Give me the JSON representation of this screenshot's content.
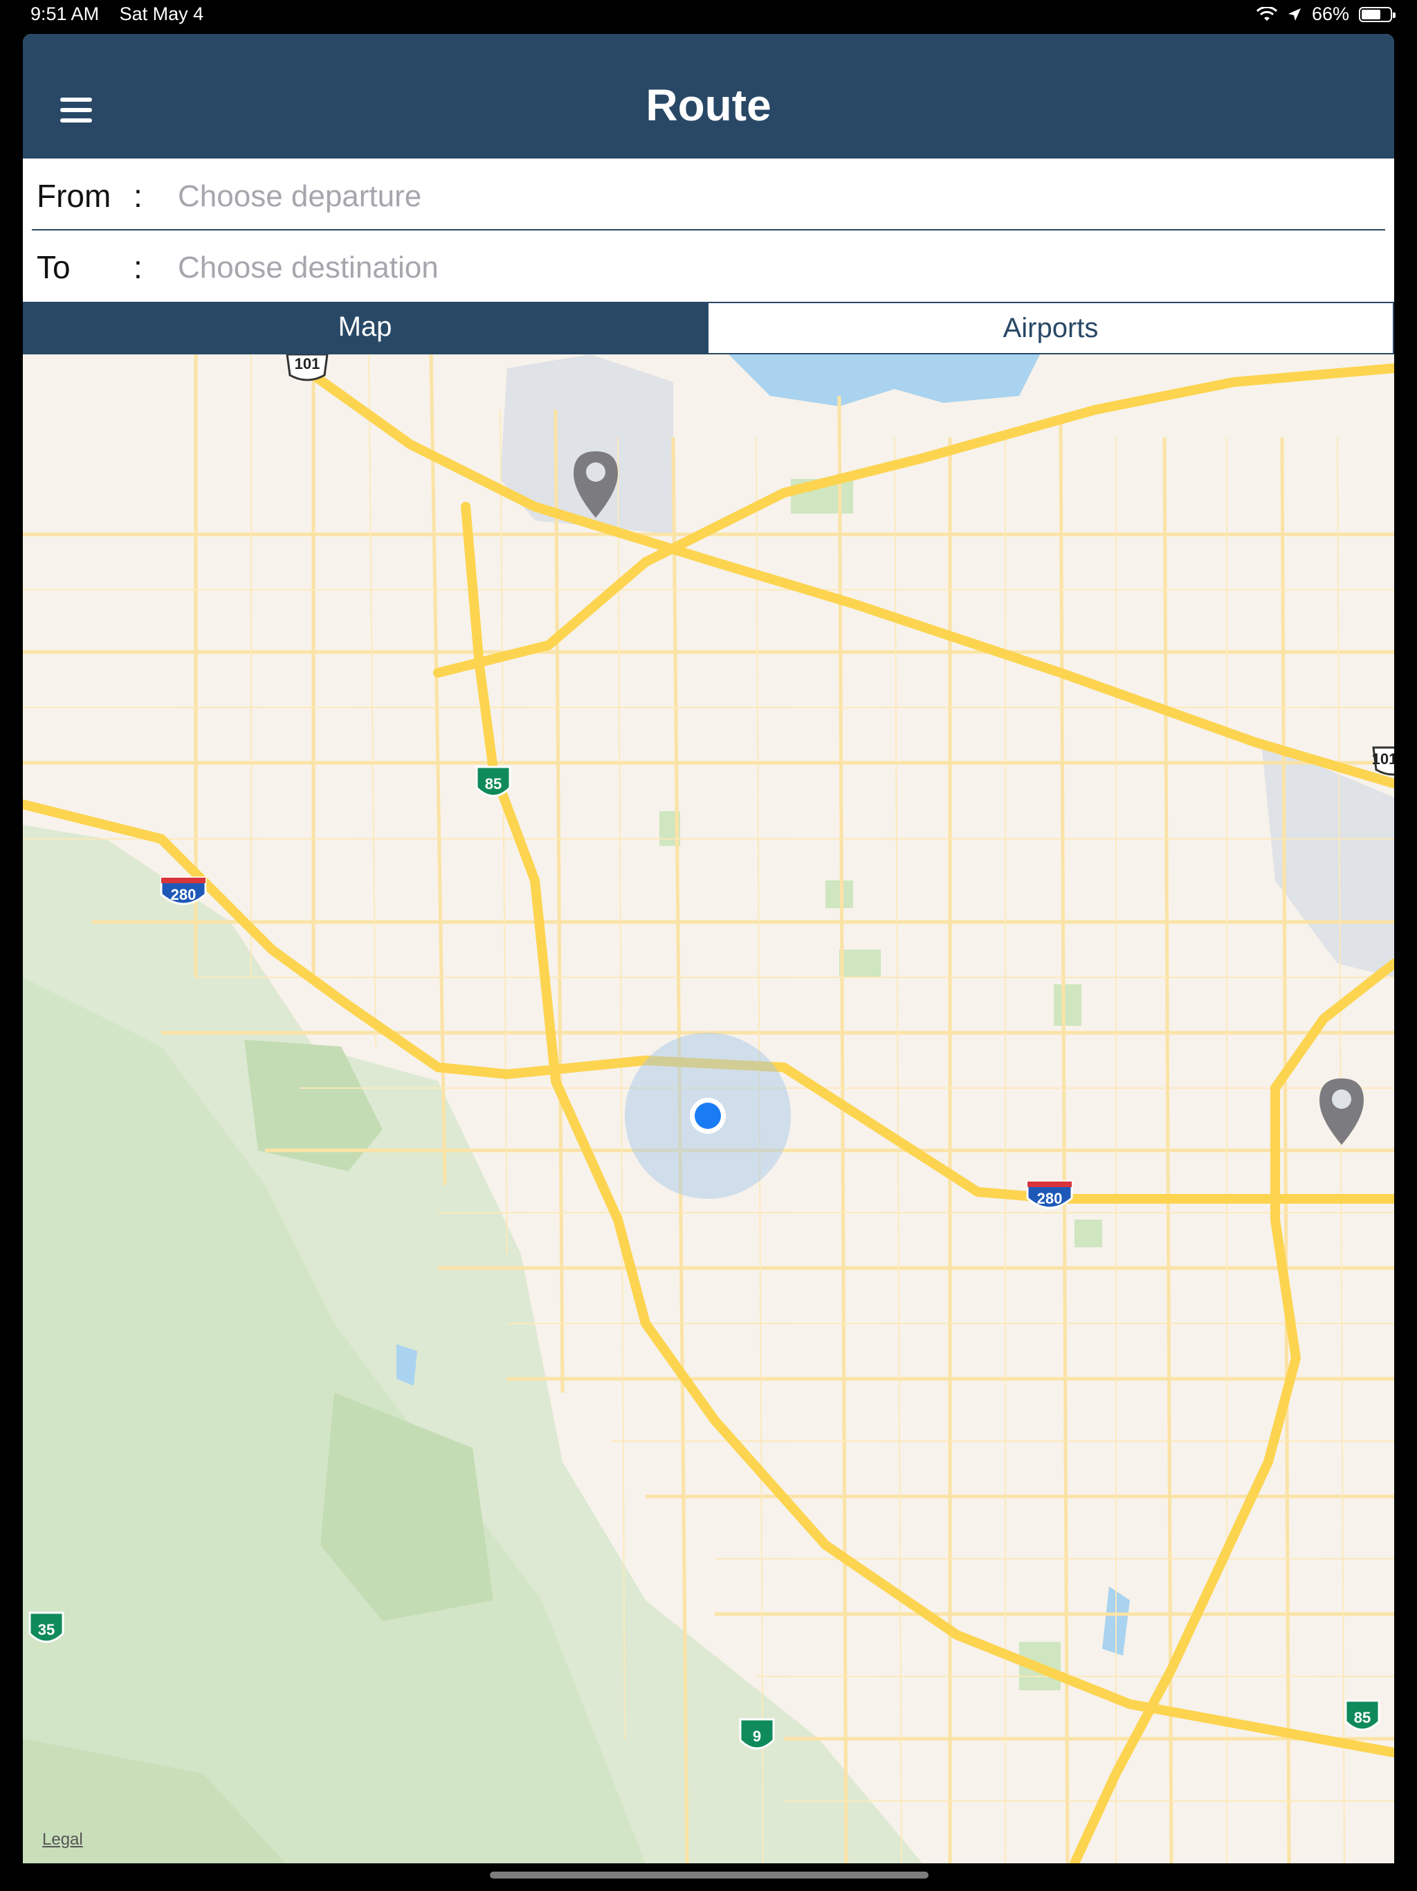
{
  "status_bar": {
    "time": "9:51 AM",
    "date": "Sat May 4",
    "battery": "66%",
    "battery_level": 0.66
  },
  "header": {
    "title": "Route"
  },
  "form": {
    "from_label": "From",
    "to_label": "To",
    "separator": ":",
    "from_placeholder": "Choose departure",
    "to_placeholder": "Choose destination"
  },
  "tabs": {
    "map": "Map",
    "airports": "Airports",
    "selected": "Map"
  },
  "map": {
    "legal": "Legal",
    "shields": [
      {
        "label": "101",
        "type": "us"
      },
      {
        "label": "101",
        "type": "us"
      },
      {
        "label": "85",
        "type": "state"
      },
      {
        "label": "85",
        "type": "state"
      },
      {
        "label": "280",
        "type": "interstate"
      },
      {
        "label": "280",
        "type": "interstate"
      },
      {
        "label": "35",
        "type": "state"
      },
      {
        "label": "9",
        "type": "state"
      }
    ]
  },
  "colors": {
    "nav": "#284866",
    "highway": "#fcd44f",
    "user_dot": "#1a7cf5",
    "interstate": "#1e59b8",
    "state_route": "#0f8a5a"
  }
}
